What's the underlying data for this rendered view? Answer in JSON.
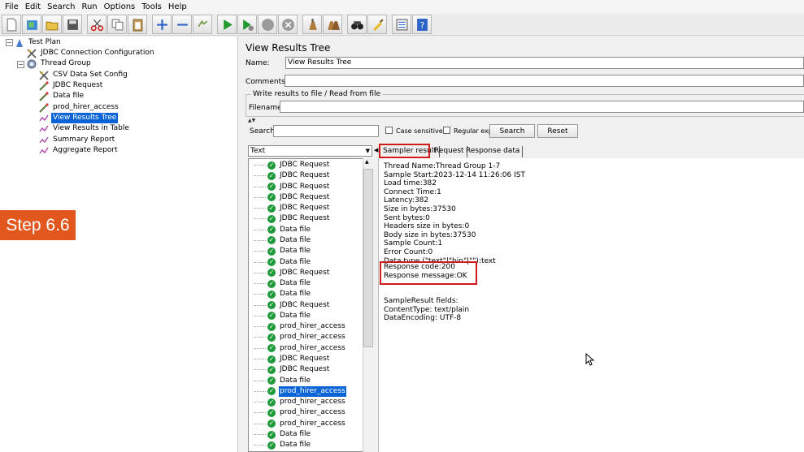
{
  "menu": [
    "File",
    "Edit",
    "Search",
    "Run",
    "Options",
    "Tools",
    "Help"
  ],
  "toolbar": [
    {
      "name": "new-icon"
    },
    {
      "name": "templates-icon"
    },
    {
      "name": "open-icon"
    },
    {
      "name": "save-icon"
    },
    {
      "name": "cut-icon"
    },
    {
      "name": "copy-icon"
    },
    {
      "name": "paste-icon"
    },
    {
      "name": "expand-icon"
    },
    {
      "name": "collapse-icon"
    },
    {
      "name": "toggle-icon"
    },
    {
      "name": "start-icon"
    },
    {
      "name": "start-no-pauses-icon"
    },
    {
      "name": "stop-icon"
    },
    {
      "name": "shutdown-icon"
    },
    {
      "name": "clear-icon"
    },
    {
      "name": "clear-all-icon"
    },
    {
      "name": "search-binoculars-icon"
    },
    {
      "name": "reset-search-icon"
    },
    {
      "name": "function-helper-icon"
    },
    {
      "name": "help-icon"
    }
  ],
  "tree": [
    {
      "label": "Test Plan",
      "icon": "test-plan-icon"
    },
    {
      "label": "JDBC Connection Configuration",
      "icon": "config-icon"
    },
    {
      "label": "Thread Group",
      "icon": "thread-group-icon"
    },
    {
      "label": "CSV Data Set Config",
      "icon": "config-icon"
    },
    {
      "label": "JDBC Request",
      "icon": "sampler-icon"
    },
    {
      "label": "Data file",
      "icon": "sampler-icon"
    },
    {
      "label": "prod_hirer_access",
      "icon": "sampler-icon"
    },
    {
      "label": "View Results Tree",
      "icon": "listener-icon"
    },
    {
      "label": "View Results in Table",
      "icon": "listener-icon"
    },
    {
      "label": "Summary Report",
      "icon": "listener-icon"
    },
    {
      "label": "Aggregate Report",
      "icon": "listener-icon"
    }
  ],
  "overlay": {
    "step_label": "Step 6.6"
  },
  "panel": {
    "title": "View Results Tree",
    "name_label": "Name:",
    "name_value": "View Results Tree",
    "comments_label": "Comments:",
    "write_legend": "Write results to file / Read from file",
    "filename_label": "Filename",
    "search_label": "Search:",
    "case_sensitive": "Case sensitive",
    "regular_exp": "Regular exp.",
    "search_button": "Search",
    "reset_button": "Reset",
    "renderer": "Text"
  },
  "results": [
    "JDBC Request",
    "JDBC Request",
    "JDBC Request",
    "JDBC Request",
    "JDBC Request",
    "JDBC Request",
    "Data file",
    "Data file",
    "Data file",
    "Data file",
    "JDBC Request",
    "Data file",
    "Data file",
    "JDBC Request",
    "Data file",
    "prod_hirer_access",
    "prod_hirer_access",
    "prod_hirer_access",
    "JDBC Request",
    "JDBC Request",
    "Data file",
    "prod_hirer_access",
    "prod_hirer_access",
    "prod_hirer_access",
    "prod_hirer_access",
    "Data file",
    "Data file"
  ],
  "tabs": [
    "Sampler result",
    "Request",
    "Response data"
  ],
  "details": [
    "Thread Name:Thread Group 1-7",
    "Sample Start:2023-12-14 11:26:06 IST",
    "Load time:382",
    "Connect Time:1",
    "Latency:382",
    "Size in bytes:37530",
    "Sent bytes:0",
    "Headers size in bytes:0",
    "Body size in bytes:37530",
    "Sample Count:1",
    "Error Count:0",
    "Data type (\"text\"|\"bin\"|\"\"):text",
    "Response code:200",
    "Response message:OK",
    "",
    "SampleResult fields:",
    "ContentType: text/plain",
    "DataEncoding: UTF-8"
  ],
  "colors": {
    "selection": "#0a64d6",
    "highlight": "#d11a1a",
    "step_badge": "#e2571e",
    "success": "#1f9a3b"
  }
}
